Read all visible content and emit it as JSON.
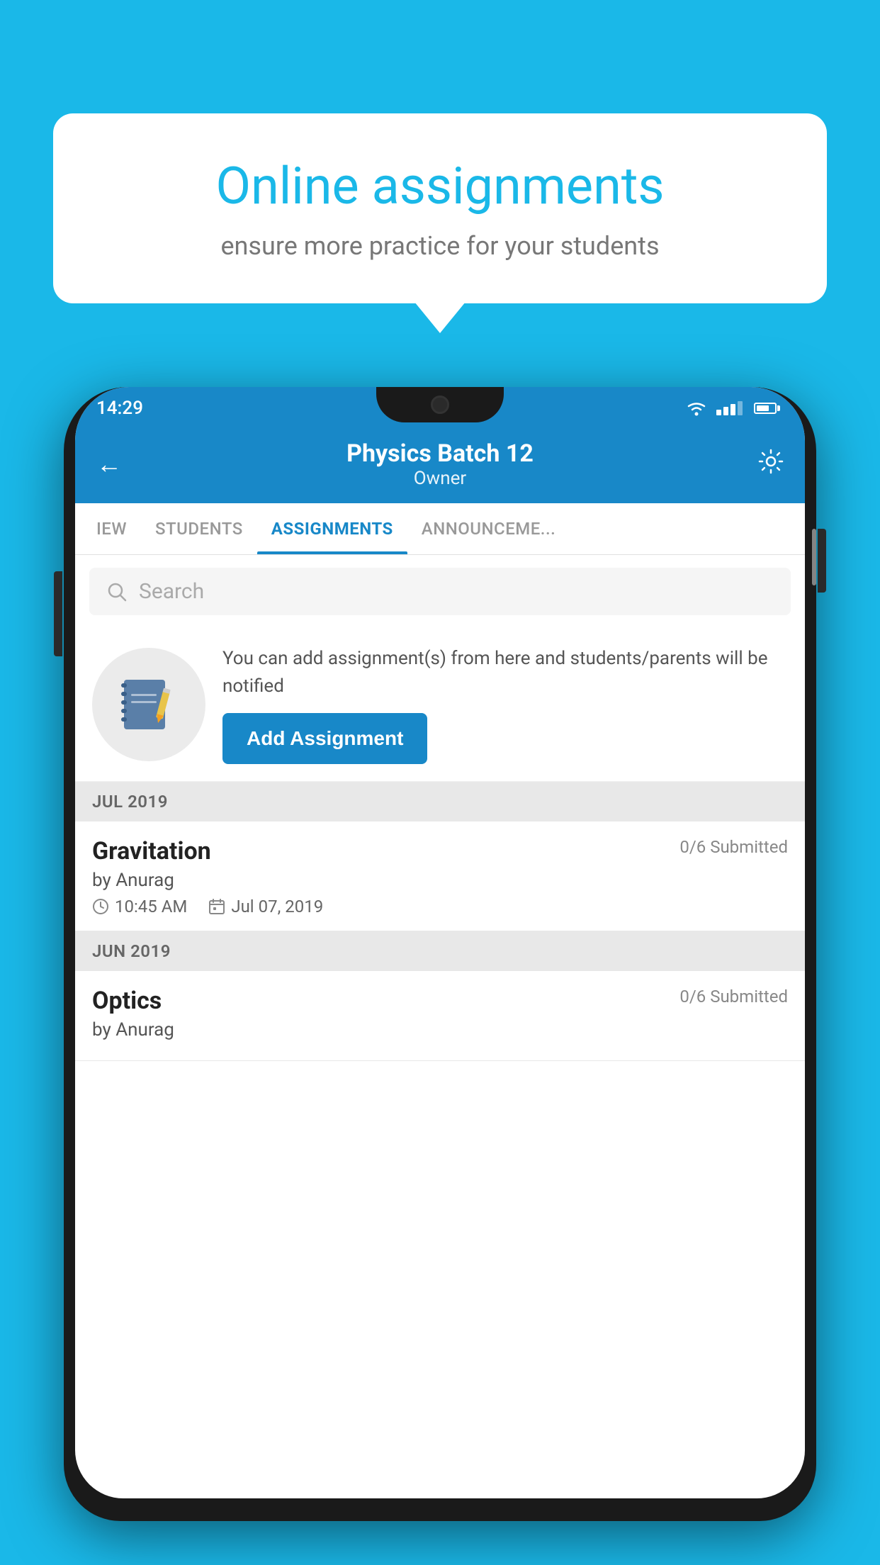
{
  "background_color": "#1ab8e8",
  "speech_bubble": {
    "title": "Online assignments",
    "subtitle": "ensure more practice for your students"
  },
  "status_bar": {
    "time": "14:29"
  },
  "header": {
    "title": "Physics Batch 12",
    "subtitle": "Owner",
    "back_label": "←",
    "settings_label": "⚙"
  },
  "tabs": [
    {
      "label": "IEW",
      "active": false
    },
    {
      "label": "STUDENTS",
      "active": false
    },
    {
      "label": "ASSIGNMENTS",
      "active": true
    },
    {
      "label": "ANNOUNCEME...",
      "active": false
    }
  ],
  "search": {
    "placeholder": "Search"
  },
  "promo": {
    "text": "You can add assignment(s) from here and students/parents will be notified",
    "button_label": "Add Assignment"
  },
  "sections": [
    {
      "label": "JUL 2019",
      "assignments": [
        {
          "name": "Gravitation",
          "submitted": "0/6 Submitted",
          "by": "by Anurag",
          "time": "10:45 AM",
          "date": "Jul 07, 2019"
        }
      ]
    },
    {
      "label": "JUN 2019",
      "assignments": [
        {
          "name": "Optics",
          "submitted": "0/6 Submitted",
          "by": "by Anurag",
          "time": "",
          "date": ""
        }
      ]
    }
  ]
}
